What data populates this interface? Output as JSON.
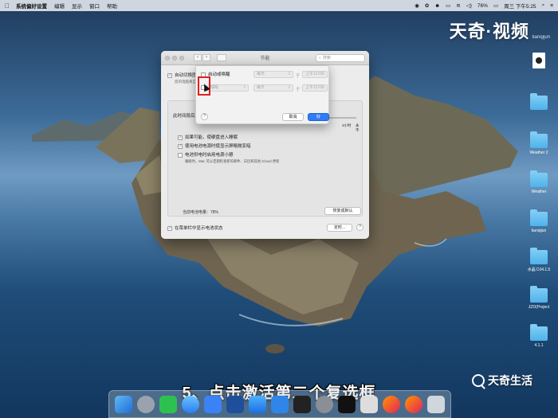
{
  "menubar": {
    "app": "系统偏好设置",
    "items": [
      "编辑",
      "显示",
      "窗口",
      "帮助"
    ],
    "battery": "76%",
    "clock": "周三 下午5:25"
  },
  "watermark": {
    "top": "天奇·视频",
    "top_sub": "tianqijun",
    "bottom": "天奇生活"
  },
  "subtitle": "5、点击激活第二个复选框",
  "desktop_icons": [
    "Weather 2",
    "Weather",
    "tianqijun",
    "水晶 DJ4.1.5",
    "JZD(Project",
    "4.1.1"
  ],
  "window": {
    "title": "节能",
    "search_placeholder": "搜索",
    "auto_switch": "自动切换图形",
    "auto_switch_sub": "您的电脑将自动",
    "turn_off_label": "此时间段后关",
    "after_time": "3小时",
    "never": "永不",
    "opt1": "如果可能，使硬盘进入睡眠",
    "opt2": "使用电池电源时使显示屏略微变暗",
    "opt3": "电池供电时启用电源小憩",
    "opt3_sub": "睡眠时，Mac 可以定期检查新的邮件、日历和其他 iCloud 更新",
    "battery_level": "当前电池电量：78%",
    "restore_defaults": "恢复成默认",
    "show_battery": "在菜单栏中显示电池状态",
    "schedule": "定时..."
  },
  "sheet": {
    "row1_label": "启动或唤醒",
    "row1_day": "每天",
    "row1_at": "于",
    "row1_time": "上午12:00",
    "row2_action": "睡眠",
    "row2_day": "每天",
    "row2_at": "于",
    "row2_time": "上午12:00",
    "cancel": "取消",
    "ok": "好"
  }
}
